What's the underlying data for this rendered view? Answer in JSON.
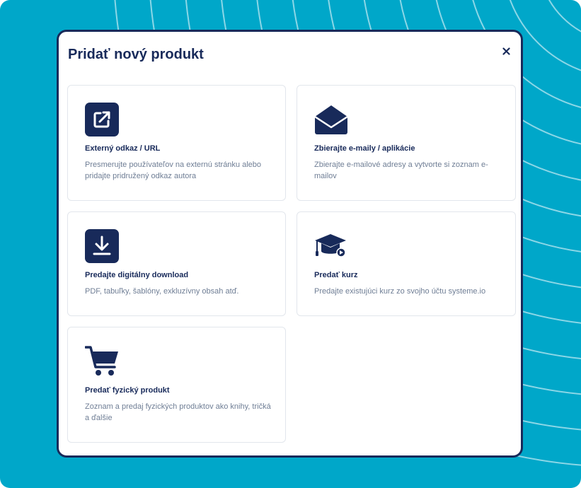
{
  "modal": {
    "title": "Pridať nový produkt",
    "close_label": "×"
  },
  "cards": [
    {
      "icon": "external-link-icon",
      "title": "Externý odkaz / URL",
      "description": "Presmerujte používateľov na externú stránku alebo pridajte pridružený odkaz autora"
    },
    {
      "icon": "envelope-icon",
      "title": "Zbierajte e-maily / aplikácie",
      "description": "Zbierajte e-mailové adresy a vytvorte si zoznam e-mailov"
    },
    {
      "icon": "download-icon",
      "title": "Predajte digitálny download",
      "description": "PDF, tabuľky, šablóny, exkluzívny obsah atď."
    },
    {
      "icon": "graduation-cap-icon",
      "title": "Predať kurz",
      "description": "Predajte existujúci kurz zo svojho účtu systeme.io"
    },
    {
      "icon": "shopping-cart-icon",
      "title": "Predať fyzický produkt",
      "description": "Zoznam a predaj fyzických produktov ako knihy, tričká a ďalšie"
    }
  ],
  "colors": {
    "backdrop": "#00a7c9",
    "primary": "#182a5a",
    "muted_text": "#6f7e95",
    "card_border": "#e2e6ec"
  }
}
